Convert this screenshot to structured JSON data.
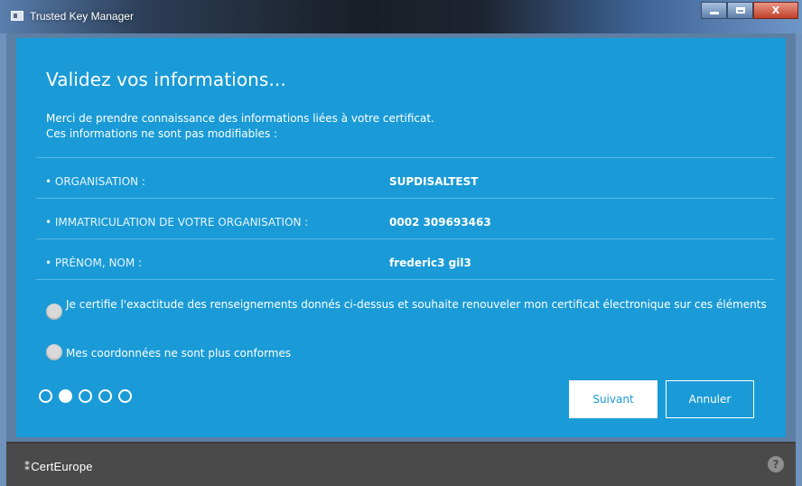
{
  "window": {
    "title": "Trusted Key Manager",
    "controls": {
      "minimize_icon": "minimize-icon",
      "maximize_icon": "maximize-icon",
      "close_label": "X"
    }
  },
  "main": {
    "heading": "Validez vos informations...",
    "intro_line1": "Merci de prendre connaissance des informations liées à votre certificat.",
    "intro_line2": "Ces informations ne sont pas modifiables :",
    "fields": [
      {
        "label": "• ORGANISATION :",
        "value": "SUPDISALTEST"
      },
      {
        "label": "• IMMATRICULATION DE VOTRE ORGANISATION :",
        "value": "0002 309693463"
      },
      {
        "label": "• PRÉNOM, NOM :",
        "value": "frederic3 gil3"
      }
    ],
    "options": [
      {
        "label": "Je certifie l'exactitude des renseignements donnés ci-dessus et souhaite renouveler mon certificat électronique sur ces éléments",
        "selected": false
      },
      {
        "label": "Mes coordonnées ne sont plus conformes",
        "selected": false
      }
    ],
    "steps": {
      "total": 5,
      "current": 2
    },
    "buttons": {
      "next": "Suivant",
      "cancel": "Annuler"
    }
  },
  "footer": {
    "brand": "CertEurope",
    "help_label": "?"
  },
  "colors": {
    "accent": "#1a9bd7",
    "footer": "#4a4a4a"
  }
}
